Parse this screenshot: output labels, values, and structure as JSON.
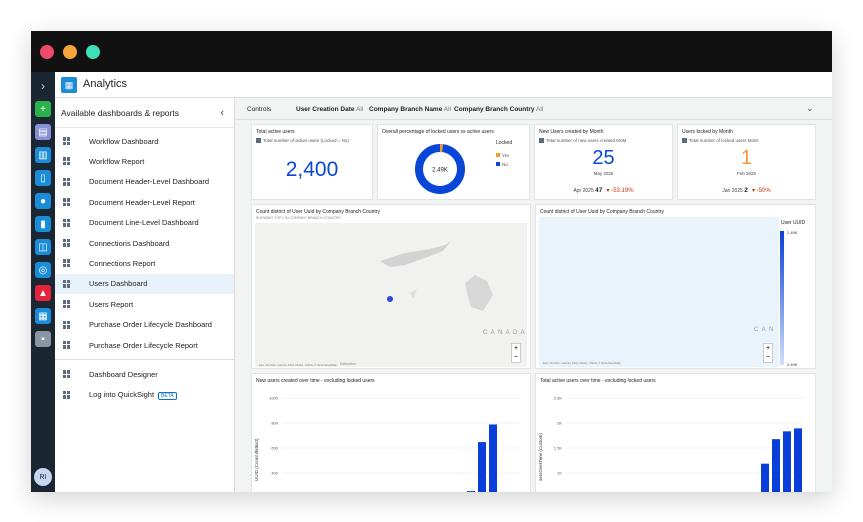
{
  "app": {
    "title": "Analytics",
    "avatar_initials": "RI"
  },
  "rail_icons": [
    {
      "name": "plus-icon",
      "color": "#2bb24c"
    },
    {
      "name": "chat-icon",
      "color": "#8a8fd6"
    },
    {
      "name": "inbox-icon",
      "color": "#1a8cd8"
    },
    {
      "name": "clipboard-icon",
      "color": "#1a8cd8"
    },
    {
      "name": "users-icon",
      "color": "#1a8cd8"
    },
    {
      "name": "book-icon",
      "color": "#1a8cd8"
    },
    {
      "name": "hierarchy-icon",
      "color": "#1a8cd8"
    },
    {
      "name": "settings-icon",
      "color": "#1a8cd8"
    },
    {
      "name": "graduation-cap-icon",
      "color": "#e5243b"
    },
    {
      "name": "building-icon",
      "color": "#1a8cd8"
    },
    {
      "name": "apps-grid-icon",
      "color": "#8c96a3"
    }
  ],
  "panel": {
    "header": "Available dashboards & reports",
    "items": [
      "Workflow Dashboard",
      "Workflow Report",
      "Document Header-Level Dashboard",
      "Document Header-Level Report",
      "Document Line-Level Dashboard",
      "Connections Dashboard",
      "Connections Report",
      "Users Dashboard",
      "Users Report",
      "Purchase Order Lifecycle Dashboard",
      "Purchase Order Lifecycle Report"
    ],
    "selected_index": 7,
    "tools": [
      "Dashboard Designer",
      "Log into QuickSight"
    ],
    "beta": "BETA"
  },
  "controls": {
    "label": "Controls",
    "filters": [
      {
        "name": "User Creation Date",
        "value": "All"
      },
      {
        "name": "Company Branch Name",
        "value": "All"
      },
      {
        "name": "Company Branch Country",
        "value": "All"
      }
    ]
  },
  "kpi_active": {
    "title": "Total active users",
    "subtitle": "Total number of active users (Locked = No)",
    "value": "2,400"
  },
  "donut": {
    "title": "Overall percentage of locked users vs active users",
    "center": "2.49K",
    "legend_title": "Locked",
    "legend": [
      {
        "label": "Yes",
        "color": "#f39c34"
      },
      {
        "label": "No",
        "color": "#0a47d9"
      }
    ],
    "yes_fraction": 0.02
  },
  "new_users": {
    "title": "New Users created by Month",
    "subtitle": "Total number of new users created MoM",
    "value": "25",
    "period": "May 2025",
    "prev_label": "Apr 2025",
    "prev_value": "47",
    "change": "▾ -53.19%"
  },
  "locked_users": {
    "title": "Users locked by Month",
    "subtitle": "Total number of locked users MoM",
    "value": "1",
    "period": "Feb 2025",
    "prev_label": "Jan 2025",
    "prev_value": "2",
    "change": "▾ -50%"
  },
  "map1": {
    "title": "Count district of User Uuid by Company Branch Country",
    "sub": "SHOWING TOP 1 IN COMPANY BRANCH COUNTRY",
    "country": "C A N A D A",
    "city": "Edmonton",
    "attrib": "Esri, TomTom, Garmin, FAO, NOAA, USGS, © OpenStreetMap"
  },
  "map2": {
    "title": "Count district of User Uuid by Company Branch Country",
    "legend_title": "User UUID",
    "legend_max": "2.49K",
    "legend_min": "2.49K",
    "country": "C A N",
    "attrib": "Esri, TomTom, Garmin, FAO, NOAA, USGS, © OpenStreetMap"
  },
  "chart_data": [
    {
      "type": "bar",
      "title": "New users created over time - excluding locked users",
      "ylabel": "UUID (Count distinct)",
      "y_ticks": [
        "1000",
        "800",
        "600",
        "400"
      ],
      "values": [
        0.05,
        0.55,
        0.73,
        0.03
      ]
    },
    {
      "type": "bar",
      "title": "Total active users over time - excluding locked users",
      "ylabel": "sersOverTime (Custom)",
      "y_ticks": [
        "2.5K",
        "2K",
        "1.5K",
        "1K"
      ],
      "values": [
        0.33,
        0.58,
        0.66,
        0.69
      ]
    }
  ]
}
